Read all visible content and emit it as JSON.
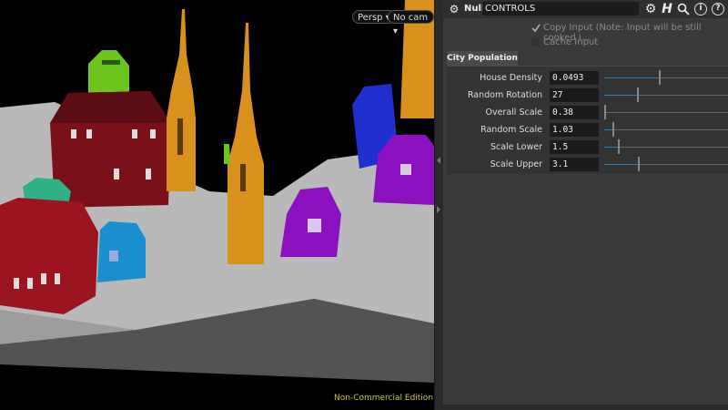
{
  "viewport": {
    "camera_view": "Persp",
    "camera_select": "No cam",
    "watermark": "Non-Commercial Edition"
  },
  "header": {
    "node_type": "Null",
    "node_name": "CONTROLS",
    "icons": [
      "gear-icon",
      "houdini-h-icon",
      "search-icon",
      "info-icon",
      "help-icon"
    ]
  },
  "options": {
    "copy_input": "Copy Input (Note: Input will be still cooked i...",
    "cache_input": "Cache Input"
  },
  "tab_label": "City Population",
  "params": [
    {
      "label": "House Density",
      "value": "0.0493",
      "level": 0.45
    },
    {
      "label": "Random Rotation",
      "value": "27",
      "level": 0.27
    },
    {
      "label": "Overall Scale",
      "value": "0.38",
      "level": 0.0
    },
    {
      "label": "Random Scale",
      "value": "1.03",
      "level": 0.07
    },
    {
      "label": "Scale Lower",
      "value": "1.5",
      "level": 0.12
    },
    {
      "label": "Scale Upper",
      "value": "3.1",
      "level": 0.28
    }
  ]
}
